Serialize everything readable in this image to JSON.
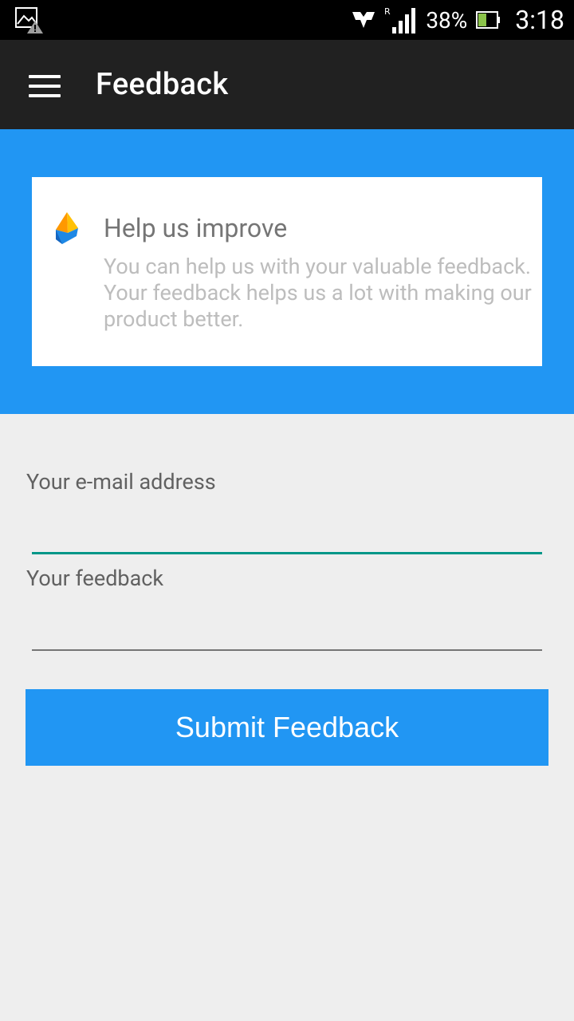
{
  "status_bar": {
    "battery_percent": "38%",
    "time": "3:18",
    "network_roaming": "R",
    "icons": [
      "gallery-alert-icon",
      "nfc-icon",
      "signal-icon",
      "battery-icon"
    ]
  },
  "app_bar": {
    "title": "Feedback",
    "menu_icon": "hamburger-menu-icon"
  },
  "hero": {
    "color": "#2196f3",
    "card": {
      "title": "Help us improve",
      "text": "You can help us with your valuable feedback. Your feedback helps us a lot with making our product better.",
      "logo_icon": "app-logo-icon"
    }
  },
  "form": {
    "email_label": "Your e-mail address",
    "email_value": "",
    "feedback_label": "Your feedback",
    "feedback_value": "",
    "submit_label": "Submit Feedback",
    "accent_color": "#009688"
  }
}
